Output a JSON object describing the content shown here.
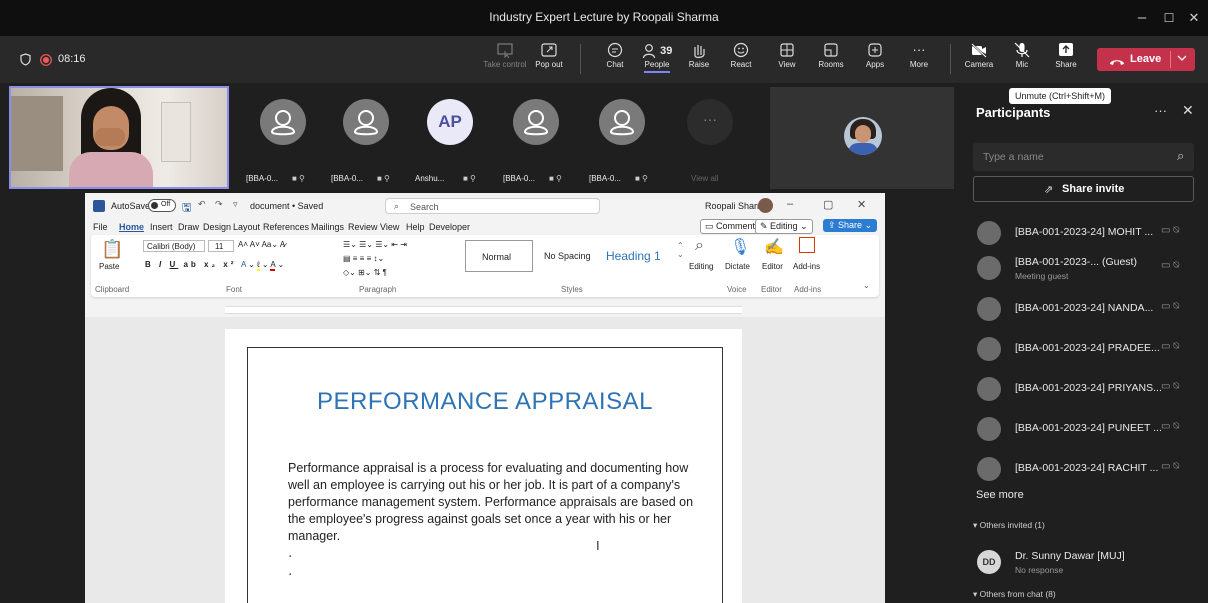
{
  "window": {
    "title": "Industry Expert Lecture by Roopali Sharma",
    "controls": [
      "–",
      "☐",
      "✕"
    ]
  },
  "meeting": {
    "timer": "08:16",
    "people_count": "39"
  },
  "toolbar": {
    "take_control": "Take control",
    "pop_out": "Pop out",
    "chat": "Chat",
    "people": "People",
    "raise": "Raise",
    "react": "React",
    "view": "View",
    "rooms": "Rooms",
    "apps": "Apps",
    "more": "More",
    "camera": "Camera",
    "mic": "Mic",
    "share": "Share",
    "leave": "Leave"
  },
  "stage": {
    "tiles": [
      {
        "name": "[BBA-0...",
        "initials": ""
      },
      {
        "name": "[BBA-0...",
        "initials": ""
      },
      {
        "name": "Anshu...",
        "initials": "AP"
      },
      {
        "name": "[BBA-0...",
        "initials": ""
      },
      {
        "name": "[BBA-0...",
        "initials": ""
      }
    ],
    "view_all": "View all"
  },
  "word": {
    "autosave": "AutoSave",
    "autosave_state": "Off",
    "doc_name": "document • Saved",
    "search": "Search",
    "user": "Roopali Sharma",
    "menu": [
      "File",
      "Home",
      "Insert",
      "Draw",
      "Design",
      "Layout",
      "References",
      "Mailings",
      "Review",
      "View",
      "Help",
      "Developer"
    ],
    "comments": "Comments",
    "editing": "Editing",
    "share": "Share",
    "font_name": "Calibri (Body)",
    "font_size": "11",
    "paste": "Paste",
    "clipboard": "Clipboard",
    "font_group": "Font",
    "paragraph_group": "Paragraph",
    "styles_group": "Styles",
    "styles": [
      "Normal",
      "No Spacing",
      "Heading 1"
    ],
    "editing_btn": "Editing",
    "dictate": "Dictate",
    "editor": "Editor",
    "addins": "Add-ins",
    "voice_group": "Voice",
    "editor_group": "Editor",
    "addins_group": "Add-ins",
    "doc_title": "PERFORMANCE APPRAISAL",
    "doc_body": "Performance appraisal is a process for evaluating and documenting how well an employee is carrying out his or her job. It is part of a company's performance management system. Performance appraisals are based on the employee's progress against goals set once a year with his or her manager."
  },
  "panel": {
    "title": "Participants",
    "tooltip": "Unmute (Ctrl+Shift+M)",
    "search_placeholder": "Type a name",
    "share_invite": "Share invite",
    "participants": [
      {
        "name": "[BBA-001-2023-24] MOHIT ...",
        "sub": ""
      },
      {
        "name": "[BBA-001-2023-...  (Guest)",
        "sub": "Meeting guest"
      },
      {
        "name": "[BBA-001-2023-24] NANDA...",
        "sub": ""
      },
      {
        "name": "[BBA-001-2023-24] PRADEE...",
        "sub": ""
      },
      {
        "name": "[BBA-001-2023-24] PRIYANS...",
        "sub": ""
      },
      {
        "name": "[BBA-001-2023-24] PUNEET ...",
        "sub": ""
      },
      {
        "name": "[BBA-001-2023-24] RACHIT ...",
        "sub": ""
      }
    ],
    "see_more": "See more",
    "others_invited": "Others invited (1)",
    "invited_name": "Dr. Sunny Dawar [MUJ]",
    "invited_initials": "DD",
    "invited_status": "No response",
    "others_chat": "Others from chat (8)"
  },
  "colors": {
    "leave": "#c4314b",
    "accent": "#7f85f5",
    "word_blue": "#2e74b5"
  }
}
